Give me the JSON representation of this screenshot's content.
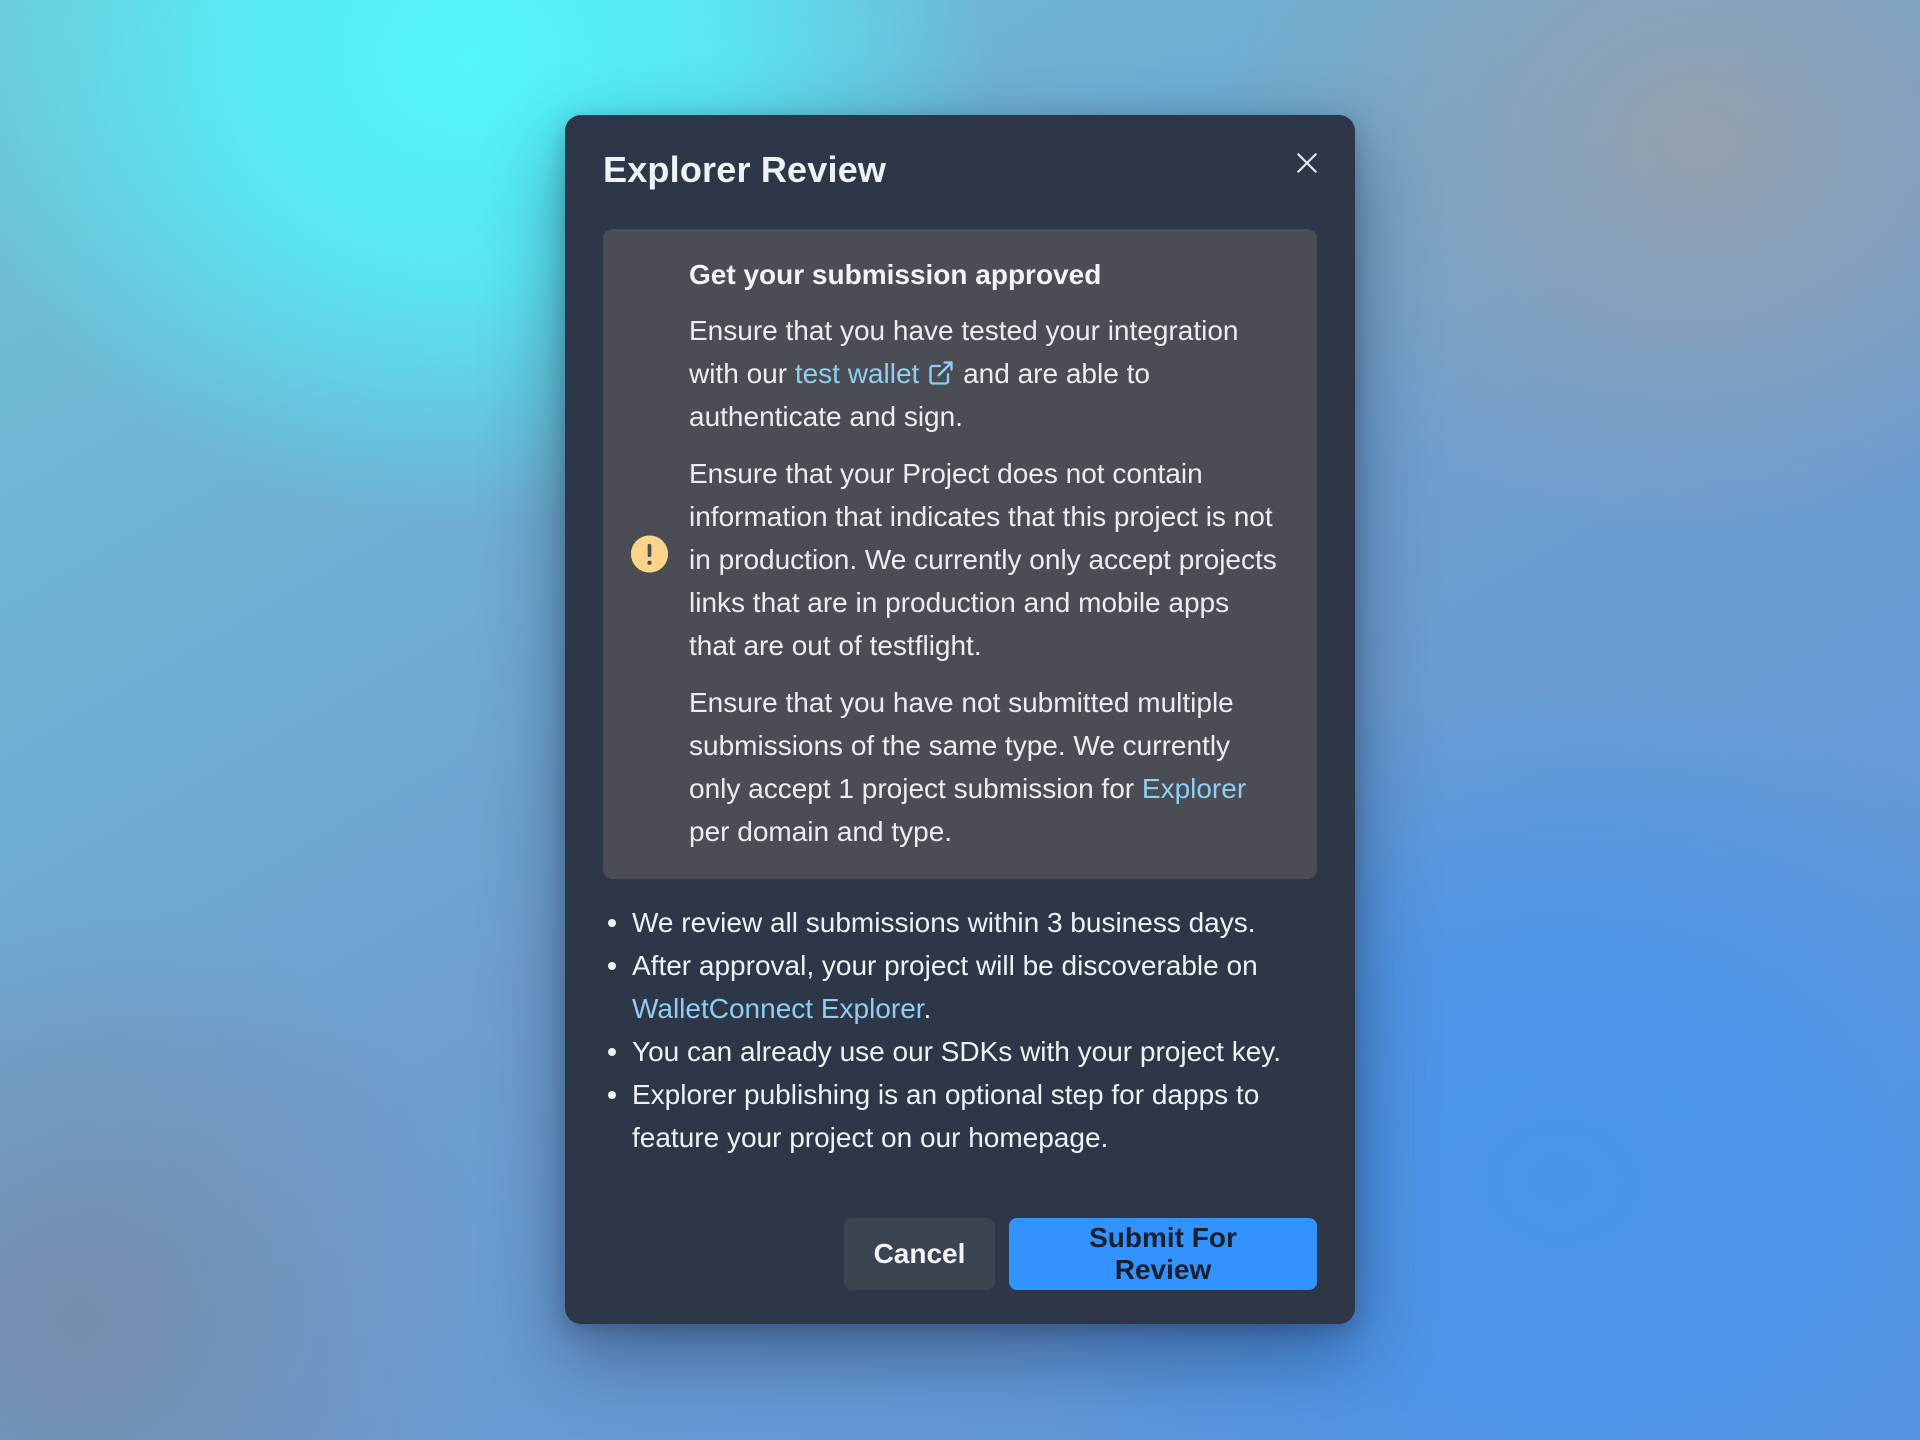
{
  "modal": {
    "title": "Explorer Review",
    "close_icon": "close-icon"
  },
  "alert": {
    "icon": "warning-icon",
    "icon_color": "#fbd38d",
    "title": "Get your submission approved",
    "para1": {
      "before_link": "Ensure that you have tested your integration with our ",
      "link_text": "test wallet",
      "link_icon": "external-link-icon",
      "after_link": " and are able to authenticate and sign."
    },
    "para2": "Ensure that your Project does not contain information that indicates that this project is not in production. We currently only accept projects links that are in production and mobile apps that are out of testflight.",
    "para3": {
      "before_link": "Ensure that you have not submitted multiple submissions of the same type. We currently only accept 1 project submission for ",
      "link_text": "Explorer",
      "after_link": " per domain and type."
    }
  },
  "info": {
    "item1": "We review all submissions within 3 business days.",
    "item2": {
      "before_link": "After approval, your project will be discoverable on ",
      "link_text": "WalletConnect Explorer",
      "after_link": "."
    },
    "item3": "You can already use our SDKs with your project key.",
    "item4": "Explorer publishing is an optional step for dapps to feature your project on our homepage."
  },
  "footer": {
    "cancel_label": "Cancel",
    "submit_label": "Submit For Review"
  },
  "colors": {
    "modal_bg": "#2d3748",
    "alert_bg": "#4a4d53",
    "link": "#90cdf4",
    "primary_button": "#3292ff",
    "secondary_button": "#3c4452"
  }
}
